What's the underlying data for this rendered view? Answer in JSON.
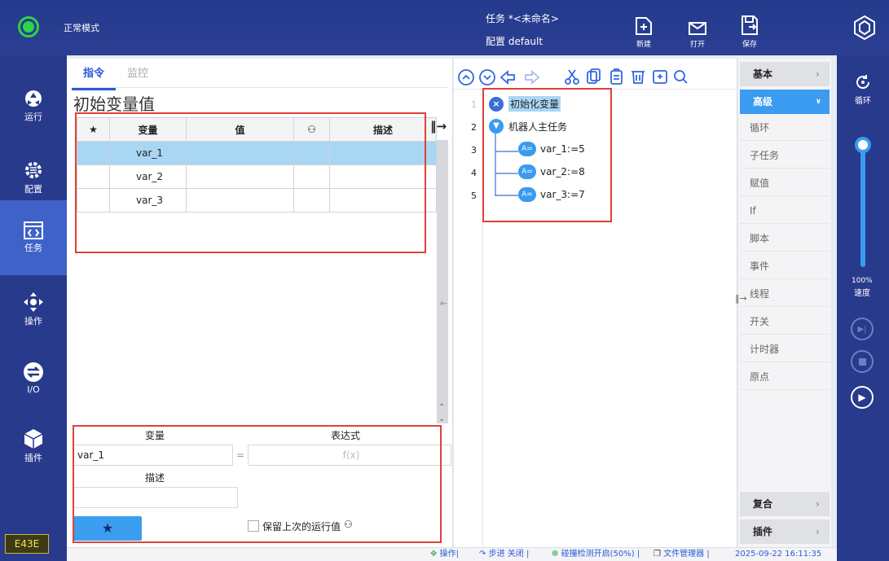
{
  "header": {
    "mode": "正常模式",
    "task_label": "任务",
    "task_name": "*<未命名>",
    "config_label": "配置",
    "config_name": "default",
    "new_label": "新建",
    "open_label": "打开",
    "save_label": "保存"
  },
  "nav": {
    "items": [
      {
        "label": "运行"
      },
      {
        "label": "配置"
      },
      {
        "label": "任务"
      },
      {
        "label": "操作"
      },
      {
        "label": "I/O"
      },
      {
        "label": "插件"
      }
    ],
    "badge": "E43E"
  },
  "panel": {
    "tabs": [
      {
        "label": "指令"
      },
      {
        "label": "监控"
      }
    ],
    "title": "初始变量值"
  },
  "var_table": {
    "headers": [
      "★",
      "变量",
      "值",
      "",
      "描述"
    ],
    "rows": [
      [
        "",
        "var_1",
        "",
        "",
        ""
      ],
      [
        "",
        "var_2",
        "",
        "",
        ""
      ],
      [
        "",
        "var_3",
        "",
        "",
        ""
      ]
    ]
  },
  "editor": {
    "var_label": "变量",
    "expr_label": "表达式",
    "var_value": "var_1",
    "equals": "=",
    "expr_placeholder": "f(x)",
    "desc_label": "描述",
    "keep_label": "保留上次的运行值"
  },
  "tree": {
    "lines": [
      "1",
      "2",
      "3",
      "4",
      "5"
    ],
    "nodes": [
      {
        "label": "初始化变量"
      },
      {
        "label": "机器人主任务"
      },
      {
        "label": "var_1:=5",
        "badge": "A="
      },
      {
        "label": "var_2:=8",
        "badge": "A="
      },
      {
        "label": "var_3:=7",
        "badge": "A="
      }
    ]
  },
  "categories": {
    "basic": "基本",
    "advanced": "高级",
    "items": [
      "循环",
      "子任务",
      "赋值",
      "If",
      "脚本",
      "事件",
      "线程",
      "开关",
      "计时器",
      "原点"
    ],
    "composite": "复合",
    "plugin": "插件"
  },
  "right": {
    "loop_label": "循环",
    "speed_value": "100%",
    "speed_label": "速度",
    "speed_fraction": 0.95
  },
  "status": {
    "operation": "操作|",
    "step": "步进 关闭",
    "collision": "碰撞检测开启(50%)",
    "filemgr": "文件管理器",
    "datetime": "2025-09-22 16:11:35"
  }
}
